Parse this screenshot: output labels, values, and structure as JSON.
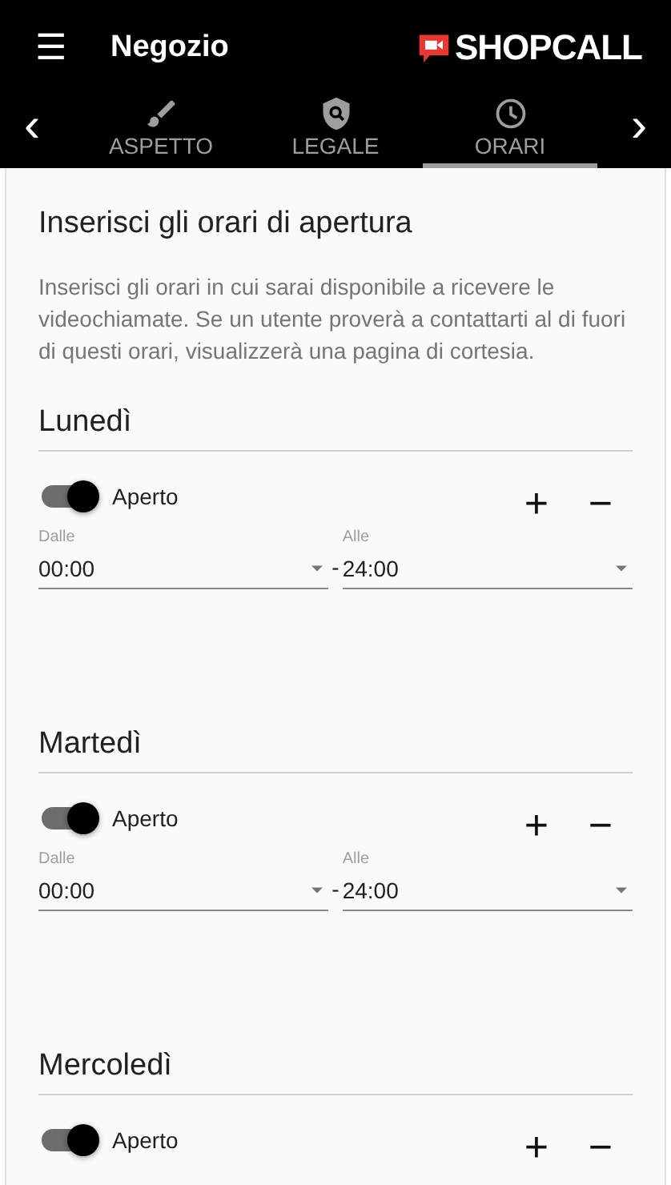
{
  "app_bar": {
    "menu": "☰",
    "title": "Negozio",
    "logo": "SHOPCALL"
  },
  "tabs": [
    {
      "label": "ASPETTO",
      "selected": false
    },
    {
      "label": "LEGALE",
      "selected": false
    },
    {
      "label": "ORARI",
      "selected": true
    }
  ],
  "tab_nav": {
    "prev": "‹",
    "next": "›"
  },
  "intro": {
    "title": "Inserisci gli orari di apertura",
    "text": "Inserisci gli orari in cui sarai disponibile a ricevere le videochiamate. Se un utente proverà a contattarti al di fuori di questi orari, visualizzerà una pagina di cortesia."
  },
  "days": [
    {
      "name": "Lunedì",
      "open": true,
      "open_label": "Aperto",
      "add": "+",
      "remove": "−",
      "slots": [
        {
          "from_label": "Dalle",
          "from": "00:00",
          "separator": "-",
          "to_label": "Alle",
          "to": "24:00"
        }
      ]
    },
    {
      "name": "Martedì",
      "open": true,
      "open_label": "Aperto",
      "add": "+",
      "remove": "−",
      "slots": [
        {
          "from_label": "Dalle",
          "from": "00:00",
          "separator": "-",
          "to_label": "Alle",
          "to": "24:00"
        }
      ]
    },
    {
      "name": "Mercoledì",
      "open": true,
      "open_label": "Aperto",
      "add": "+",
      "remove": "−"
    }
  ]
}
